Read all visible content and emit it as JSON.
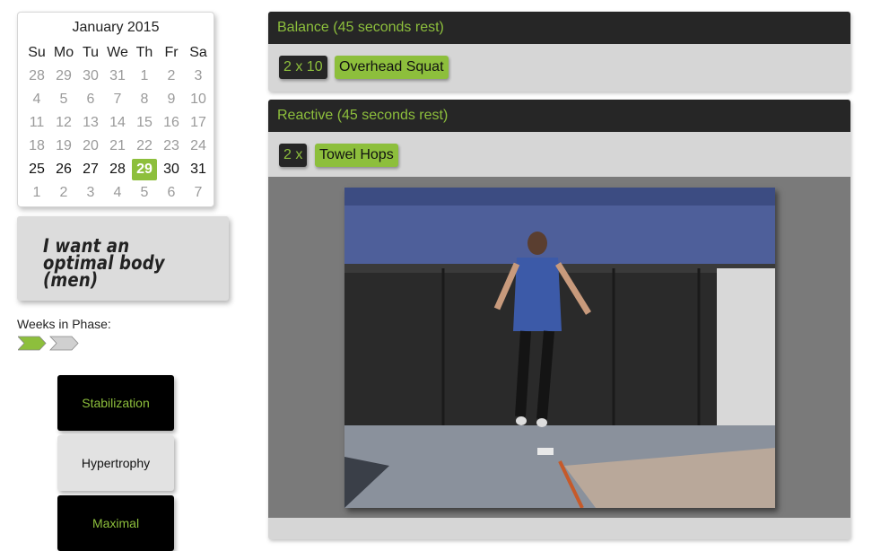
{
  "calendar": {
    "title": "January 2015",
    "weekdays": [
      "Su",
      "Mo",
      "Tu",
      "We",
      "Th",
      "Fr",
      "Sa"
    ],
    "weeks": [
      [
        "28",
        "29",
        "30",
        "31",
        "1",
        "2",
        "3"
      ],
      [
        "4",
        "5",
        "6",
        "7",
        "8",
        "9",
        "10"
      ],
      [
        "11",
        "12",
        "13",
        "14",
        "15",
        "16",
        "17"
      ],
      [
        "18",
        "19",
        "20",
        "21",
        "22",
        "23",
        "24"
      ],
      [
        "25",
        "26",
        "27",
        "28",
        "29",
        "30",
        "31"
      ],
      [
        "1",
        "2",
        "3",
        "4",
        "5",
        "6",
        "7"
      ]
    ],
    "current_week_index": 4,
    "selected_day": "29"
  },
  "program": {
    "title": "I want an optimal body (men)"
  },
  "weeks_in_phase": {
    "label": "Weeks in Phase:",
    "total_weeks": 2,
    "completed_weeks": 1,
    "active_color": "#8dbf3c",
    "inactive_color": "#d0d0d0"
  },
  "phases": [
    {
      "label": "Stabilization",
      "active": true
    },
    {
      "label": "Hypertrophy",
      "active": false
    },
    {
      "label": "Maximal",
      "active": true
    }
  ],
  "sections": [
    {
      "header": "Balance (45 seconds rest)",
      "sets": "2 x 10",
      "exercise": "Overhead Squat"
    },
    {
      "header": "Reactive (45 seconds rest)",
      "sets": "2 x",
      "exercise": "Towel Hops"
    }
  ],
  "video": {
    "description_icon": "video-player"
  },
  "colors": {
    "accent": "#8dbf3c",
    "header_bg": "#262626",
    "panel_bg": "#d6d6d6"
  }
}
